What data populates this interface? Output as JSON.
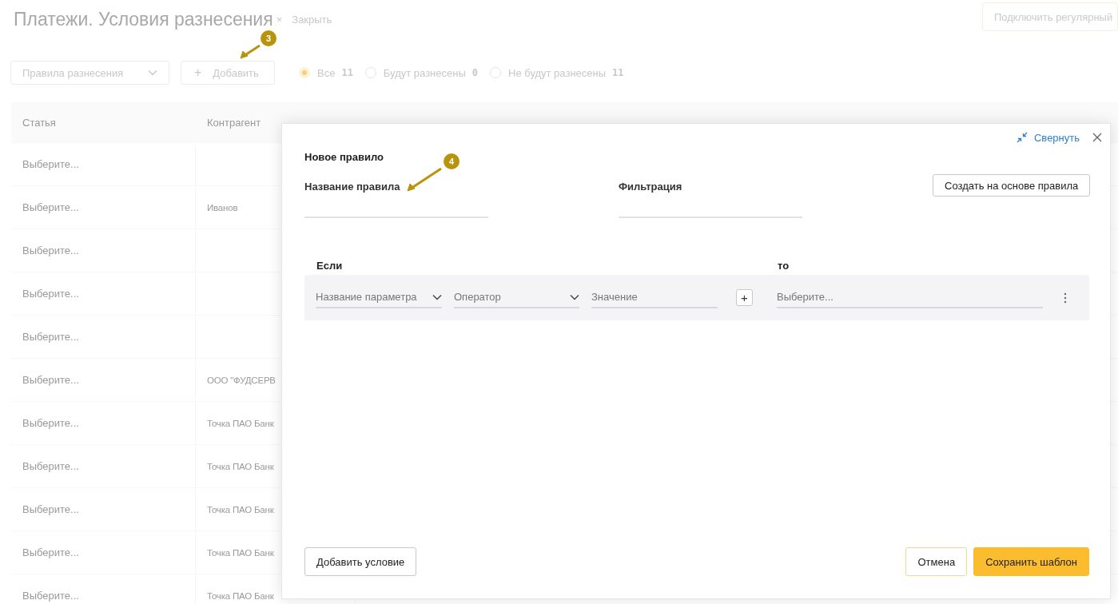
{
  "page": {
    "title": "Платежи. Условия разнесения",
    "close_icon": "×",
    "close_link": "Закрыть",
    "connect_button": "Подключить регулярный"
  },
  "toolbar": {
    "rules_dropdown": "Правила разнесения",
    "add_button": {
      "icon": "+",
      "label": "Добавить"
    },
    "filters": [
      {
        "label": "Все",
        "count": "11",
        "selected": true
      },
      {
        "label": "Будут разнесены",
        "count": "0",
        "selected": false
      },
      {
        "label": "Не будут разнесены",
        "count": "11",
        "selected": false
      }
    ]
  },
  "table": {
    "columns": [
      "Статья",
      "Контрагент"
    ],
    "rows": [
      {
        "article": "Выберите..."
      },
      {
        "article": "Выберите...",
        "counterparty": "Иванов"
      },
      {
        "article": "Выберите..."
      },
      {
        "article": "Выберите..."
      },
      {
        "article": "Выберите..."
      },
      {
        "article": "Выберите...",
        "counterparty": "ООО \"ФУДСЕРВ"
      },
      {
        "article": "Выберите...",
        "counterparty": "Точка ПАО Банк"
      },
      {
        "article": "Выберите...",
        "counterparty": "Точка ПАО Банк"
      },
      {
        "article": "Выберите...",
        "counterparty": "Точка ПАО Банк"
      },
      {
        "article": "Выберите...",
        "counterparty": "Точка ПАО Банк"
      },
      {
        "article": "Выберите...",
        "counterparty": "Точка ПАО Банк"
      }
    ]
  },
  "dialog": {
    "collapse_link": "Свернуть",
    "title": "Новое правило",
    "fields": [
      {
        "label": "Название правила"
      },
      {
        "label": "Фильтрация"
      }
    ],
    "create_from_rule_button": "Создать на основе правила",
    "if_label": "Если",
    "then_label": "то",
    "condition": {
      "parameter": "Название параметра",
      "operator": "Оператор",
      "value_placeholder": "Значение",
      "add_icon": "+",
      "action": "Выберите..."
    },
    "add_condition_button": "Добавить условие",
    "cancel_button": "Отмена",
    "save_button": "Сохранить шаблон"
  },
  "annotations": [
    {
      "number": "3"
    },
    {
      "number": "4"
    }
  ]
}
